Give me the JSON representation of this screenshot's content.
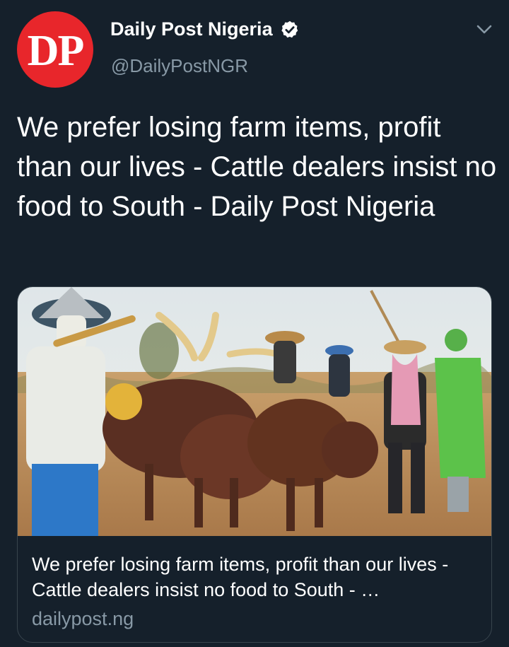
{
  "account": {
    "avatar_text": "DP",
    "display_name": "Daily Post Nigeria",
    "handle": "@DailyPostNGR",
    "verified": true
  },
  "tweet": {
    "text": "We prefer losing farm items, profit than our lives - Cattle dealers insist no food to South - Daily Post Nigeria"
  },
  "card": {
    "title": "We prefer losing farm items, profit than our lives - Cattle dealers insist no food to South - …",
    "domain": "dailypost.ng"
  },
  "icons": {
    "verified": "verified-badge-icon",
    "menu": "chevron-down-icon"
  },
  "colors": {
    "background": "#15202b",
    "text": "#ffffff",
    "secondary_text": "#8899a6",
    "border": "#38444d",
    "avatar": "#e8262b"
  }
}
